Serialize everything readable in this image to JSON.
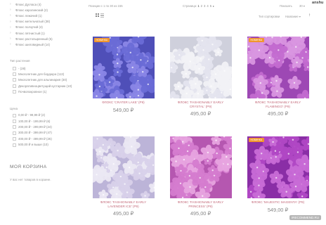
{
  "user": "anshu",
  "categories": [
    "Флокс Дугласа (4)",
    "Флокс каролинский (2)",
    "Флокс лежачий (1)",
    "Флокс метельчатый (38)",
    "Флокс ползучий (4)",
    "Флокс пятнистый (1)",
    "Флокс растопыренный (5)",
    "Флокс шиловидный (14)"
  ],
  "plant_type": {
    "title": "Тип растения",
    "options": [
      "- (28)",
      "Многолетник для бордюра (113)",
      "Многолетник для альпинария (30)",
      "Декоративноцветущий кустарник (10)",
      "Почвопокровное (1)"
    ]
  },
  "price_filter": {
    "title": "Цена",
    "options": [
      "0,00 ₽ - 99,99 ₽ (2)",
      "100,00 ₽ - 199,99 ₽ (6)",
      "200,00 ₽ - 299,99 ₽ (24)",
      "300,00 ₽ - 399,99 ₽ (47)",
      "400,00 ₽ - 499,99 ₽ (25)",
      "500,00 ₽ и выше (10)"
    ]
  },
  "cart": {
    "title": "МОЯ КОРЗИНА",
    "empty_text": "У вас нет товаров в корзине."
  },
  "toolbar": {
    "items_text": "Позиции с 1 по 30 из 155",
    "page_label": "Страница:",
    "pages": [
      "1",
      "2",
      "3",
      "4",
      "5"
    ],
    "active_page": "1",
    "next": "▸",
    "show_label": "Показать",
    "show_value": "30",
    "sort_label": "Тип сортировки",
    "sort_value": "Название",
    "sort_dir": "↑"
  },
  "products": [
    {
      "name": "ФЛОКС 'CRATER LAKE' (P9)",
      "price": "549,00 ₽",
      "badge": "НОВИНКА",
      "colors": [
        "#6a6bd6",
        "#8a86e6",
        "#4f4fb8"
      ]
    },
    {
      "name": "ФЛОКС 'FASHIONABLY EARLY CRYSTAL' (P9)",
      "price": "495,00 ₽",
      "badge": "",
      "colors": [
        "#f1f1f6",
        "#e4e4ee",
        "#cfd0dc"
      ]
    },
    {
      "name": "ФЛОКС 'FASHIONABLY EARLY FLAMINGO' (P9)",
      "price": "495,00 ₽",
      "badge": "НОВИНКА",
      "colors": [
        "#c36bd0",
        "#d996e0",
        "#9d48b4"
      ]
    },
    {
      "name": "ФЛОКС 'FASHIONABLY EARLY LAVENDER ICE' (P9)",
      "price": "495,00 ₽",
      "badge": "",
      "colors": [
        "#ebe8f3",
        "#d8d1ea",
        "#bcb4d8"
      ]
    },
    {
      "name": "ФЛОКС 'FASHIONABLY EARLY PRINCESS' (P9)",
      "price": "495,00 ₽",
      "badge": "",
      "colors": [
        "#d57ccf",
        "#e7a4df",
        "#b557b0"
      ]
    },
    {
      "name": "ФЛОКС 'MAJESTIC MAGENTA' (P9)",
      "price": "549,00 ₽",
      "badge": "НОВИНКА",
      "colors": [
        "#b048c4",
        "#c86bd6",
        "#8a2ea6"
      ]
    }
  ],
  "watermark": "IRECOMMEND.RU"
}
